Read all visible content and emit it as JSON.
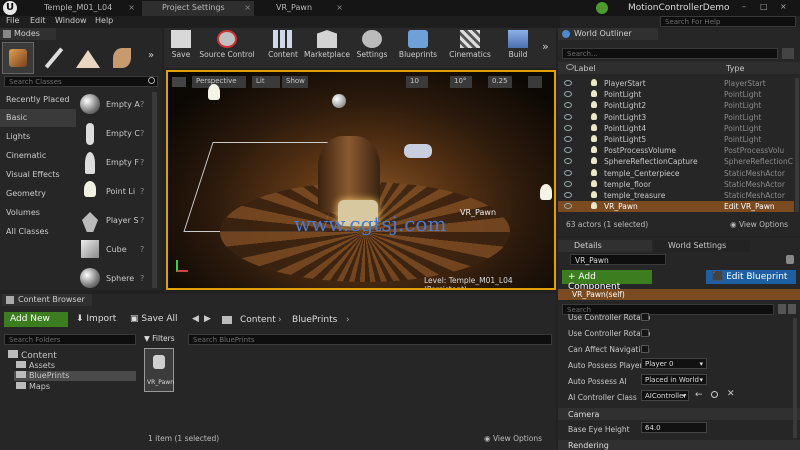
{
  "window": {
    "tabs": [
      "Temple_M01_L04",
      "Project Settings",
      "VR_Pawn"
    ],
    "app_title": "MotionControllerDemo",
    "search_help_placeholder": "Search For Help"
  },
  "menu": [
    "File",
    "Edit",
    "Window",
    "Help"
  ],
  "modes": {
    "title": "Modes",
    "search_placeholder": "Search Classes",
    "categories": [
      "Recently Placed",
      "Basic",
      "Lights",
      "Cinematic",
      "Visual Effects",
      "Geometry",
      "Volumes",
      "All Classes"
    ],
    "assets": [
      "Empty A",
      "Empty C",
      "Empty F",
      "Point Li",
      "Player S",
      "Cube",
      "Sphere"
    ]
  },
  "toolbar": [
    "Save",
    "Source Control",
    "Content",
    "Marketplace",
    "Settings",
    "Blueprints",
    "Cinematics",
    "Build"
  ],
  "viewport": {
    "perspective": "Perspective",
    "lit": "Lit",
    "show": "Show",
    "grid": "10",
    "angle": "10°",
    "scale": "0.25",
    "actor_label": "VR_Pawn",
    "level": "Level:  Temple_M01_L04 (Persistent)",
    "watermark": "www.cgtsj.com"
  },
  "outliner": {
    "title": "World Outliner",
    "search_placeholder": "Search...",
    "col_label": "Label",
    "col_type": "Type",
    "rows": [
      {
        "label": "PlayerStart",
        "type": "PlayerStart"
      },
      {
        "label": "PointLight",
        "type": "PointLight"
      },
      {
        "label": "PointLight2",
        "type": "PointLight"
      },
      {
        "label": "PointLight3",
        "type": "PointLight"
      },
      {
        "label": "PointLight4",
        "type": "PointLight"
      },
      {
        "label": "PointLight5",
        "type": "PointLight"
      },
      {
        "label": "PostProcessVolume",
        "type": "PostProcessVolu"
      },
      {
        "label": "SphereReflectionCapture",
        "type": "SphereReflectionC"
      },
      {
        "label": "temple_Centerpiece",
        "type": "StaticMeshActor"
      },
      {
        "label": "temple_floor",
        "type": "StaticMeshActor"
      },
      {
        "label": "temple_treasure",
        "type": "StaticMeshActor"
      },
      {
        "label": "VR_Pawn",
        "type": "Edit VR_Pawn"
      }
    ],
    "status": "63 actors (1 selected)",
    "view_options": "View Options"
  },
  "details": {
    "tab_details": "Details",
    "tab_world": "World Settings",
    "name_value": "VR_Pawn",
    "add_component": "+ Add Component",
    "edit_blueprint": "Edit Blueprint",
    "self_label": "VR_Pawn(self)",
    "search_placeholder": "Search",
    "props": [
      {
        "label": "Use Controller Rotatio"
      },
      {
        "label": "Use Controller Rotatio"
      },
      {
        "label": "Can Affect Navigation"
      },
      {
        "label": "Auto Possess Player",
        "value": "Player 0"
      },
      {
        "label": "Auto Possess AI",
        "value": "Placed in World"
      },
      {
        "label": "AI Controller Class",
        "value": "AIController"
      }
    ],
    "camera_section": "Camera",
    "eye_height_label": "Base Eye Height",
    "eye_height_value": "64.0",
    "rendering_section": "Rendering"
  },
  "content_browser": {
    "title": "Content Browser",
    "add_new": "Add New",
    "import": "Import",
    "save_all": "Save All",
    "path": [
      "Content",
      "BluePrints"
    ],
    "folder_search_placeholder": "Search Folders",
    "filters": "Filters",
    "asset_search_placeholder": "Search BluePrints",
    "folders": [
      "Content",
      "Assets",
      "BluePrints",
      "Maps"
    ],
    "asset_name": "VR_Pawn",
    "status": "1 item (1 selected)",
    "view_options": "View Options"
  }
}
